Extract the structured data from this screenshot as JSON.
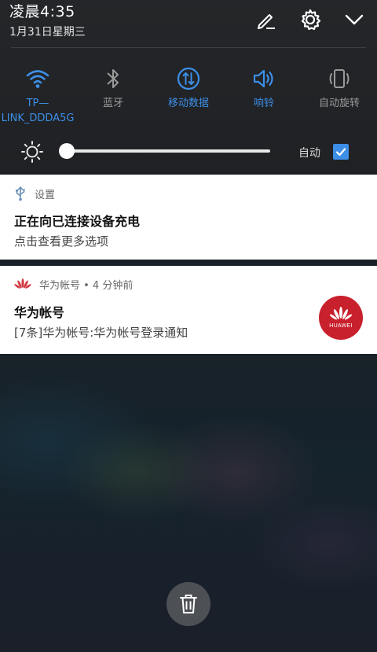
{
  "status": {
    "time": "凌晨4:35",
    "date": "1月31日星期三"
  },
  "top_actions": {
    "edit_icon": "pencil-icon",
    "settings_icon": "gear-icon",
    "collapse_icon": "chevron-down-icon"
  },
  "quick_settings": [
    {
      "label": "TP—\nLINK_DDDA5G",
      "line1": "TP—",
      "line2": "LINK_DDDA5G",
      "icon": "wifi-icon",
      "active": true
    },
    {
      "label": "蓝牙",
      "icon": "bluetooth-icon",
      "active": false
    },
    {
      "label": "移动数据",
      "icon": "mobile-data-icon",
      "active": true
    },
    {
      "label": "响铃",
      "icon": "speaker-icon",
      "active": true
    },
    {
      "label": "自动旋转",
      "icon": "rotate-icon",
      "active": false
    }
  ],
  "brightness": {
    "level": 0.0,
    "auto_label": "自动",
    "auto_checked": true
  },
  "notifications": [
    {
      "app": "设置",
      "icon": "usb-icon",
      "title": "正在向已连接设备充电",
      "text": "点击查看更多选项"
    },
    {
      "app": "华为帐号 • 4 分钟前",
      "icon": "huawei-logo-icon",
      "title": "华为帐号",
      "text": "[7条]华为帐号:华为帐号登录通知",
      "badge_text": "HUAWEI"
    }
  ],
  "clear_button_icon": "trash-icon",
  "colors": {
    "accent": "#3d8ee6",
    "inactive": "#9a9a9a",
    "huawei_red": "#c8202c"
  }
}
